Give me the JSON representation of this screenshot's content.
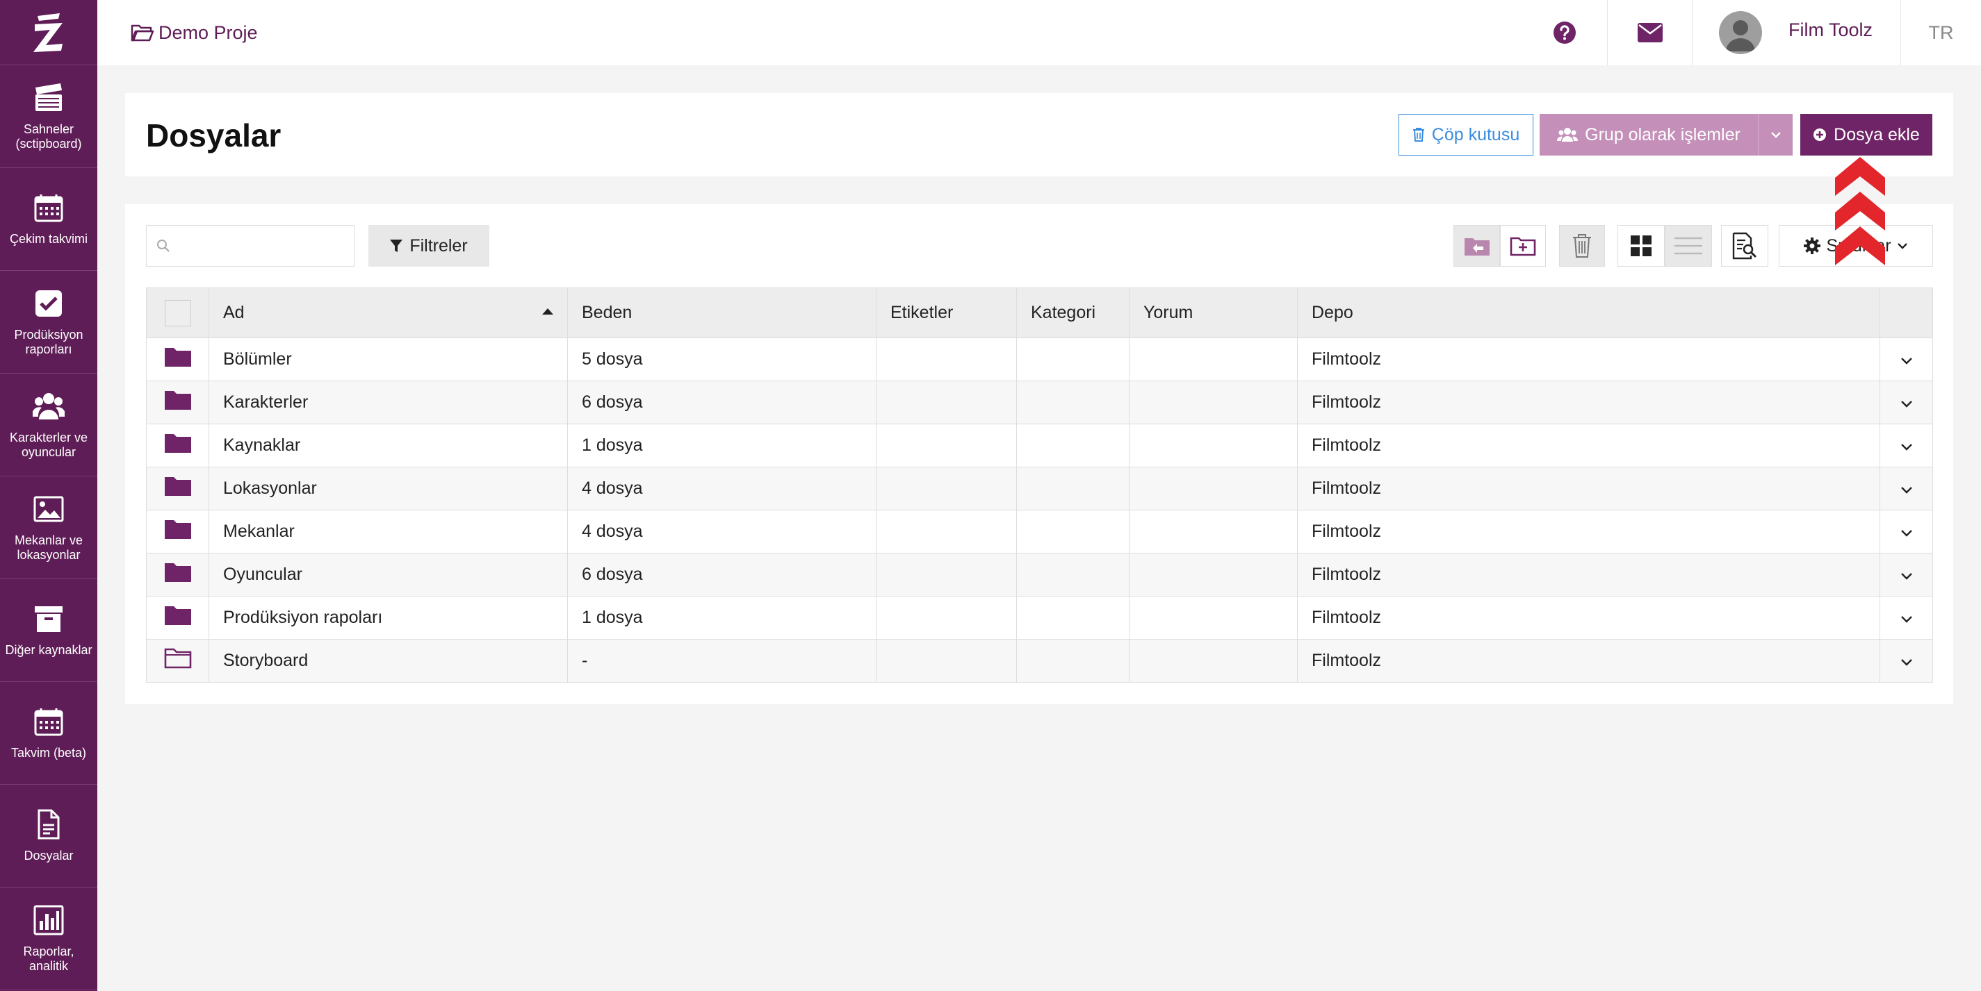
{
  "app": {
    "logo_text": "Z",
    "accent": "#5e1d56"
  },
  "sidebar": {
    "items": [
      {
        "label": "Sahneler (sctipboard)",
        "icon": "clapperboard-icon"
      },
      {
        "label": "Çekim takvimi",
        "icon": "calendar-icon"
      },
      {
        "label": "Prodüksiyon raporları",
        "icon": "checkbox-icon"
      },
      {
        "label": "Karakterler ve oyuncular",
        "icon": "users-icon"
      },
      {
        "label": "Mekanlar ve lokasyonlar",
        "icon": "image-icon"
      },
      {
        "label": "Diğer kaynaklar",
        "icon": "archive-icon"
      },
      {
        "label": "Takvim (beta)",
        "icon": "calendar-grid-icon"
      },
      {
        "label": "Dosyalar",
        "icon": "document-icon"
      },
      {
        "label": "Raporlar, analitik",
        "icon": "bar-chart-icon"
      }
    ]
  },
  "topbar": {
    "project": "Demo Proje",
    "user_name": "Film Toolz",
    "language": "TR"
  },
  "header": {
    "title": "Dosyalar",
    "trash_label": "Çöp kutusu",
    "group_label": "Grup olarak işlemler",
    "add_label": "Dosya ekle"
  },
  "toolbar": {
    "search_placeholder": "",
    "filters_label": "Filtreler",
    "columns_label": "Sutunlar"
  },
  "table": {
    "columns": [
      "Ad",
      "Beden",
      "Etiketler",
      "Kategori",
      "Yorum",
      "Depo"
    ],
    "rows": [
      {
        "name": "Bölümler",
        "size": "5 dosya",
        "tags": "",
        "category": "",
        "comment": "",
        "storage": "Filmtoolz",
        "empty": false
      },
      {
        "name": "Karakterler",
        "size": "6 dosya",
        "tags": "",
        "category": "",
        "comment": "",
        "storage": "Filmtoolz",
        "empty": false
      },
      {
        "name": "Kaynaklar",
        "size": "1 dosya",
        "tags": "",
        "category": "",
        "comment": "",
        "storage": "Filmtoolz",
        "empty": false
      },
      {
        "name": "Lokasyonlar",
        "size": "4 dosya",
        "tags": "",
        "category": "",
        "comment": "",
        "storage": "Filmtoolz",
        "empty": false
      },
      {
        "name": "Mekanlar",
        "size": "4 dosya",
        "tags": "",
        "category": "",
        "comment": "",
        "storage": "Filmtoolz",
        "empty": false
      },
      {
        "name": "Oyuncular",
        "size": "6 dosya",
        "tags": "",
        "category": "",
        "comment": "",
        "storage": "Filmtoolz",
        "empty": false
      },
      {
        "name": "Prodüksiyon rapoları",
        "size": "1 dosya",
        "tags": "",
        "category": "",
        "comment": "",
        "storage": "Filmtoolz",
        "empty": false
      },
      {
        "name": "Storyboard",
        "size": "-",
        "tags": "",
        "category": "",
        "comment": "",
        "storage": "Filmtoolz",
        "empty": true
      }
    ]
  }
}
